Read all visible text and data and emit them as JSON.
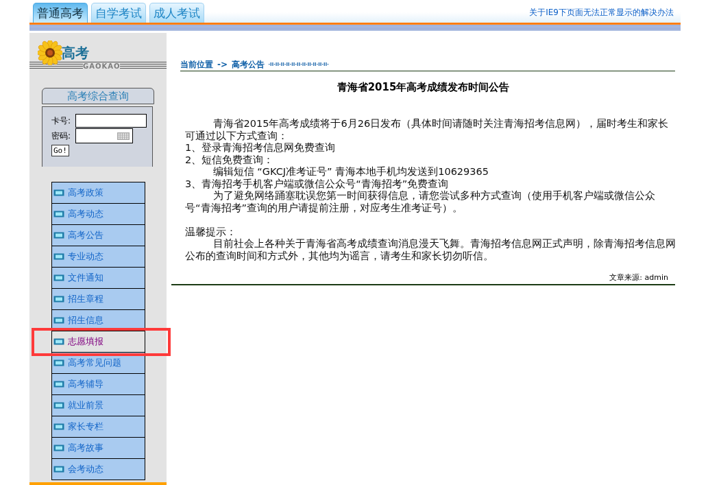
{
  "header": {
    "tabs": [
      {
        "label": "普通高考",
        "selected": true
      },
      {
        "label": "自学考试",
        "selected": false
      },
      {
        "label": "成人考试",
        "selected": false
      }
    ],
    "help_link": "关于IE9下页面无法正常显示的解决办法"
  },
  "sidebar": {
    "logo": {
      "title": "高考",
      "subtitle": "GAOKAO"
    },
    "login": {
      "title": "高考综合查询",
      "card_label": "卡号:",
      "password_label": "密码:",
      "submit": "Go!"
    },
    "menu": [
      {
        "label": "高考政策",
        "selected": false,
        "highlighted": false
      },
      {
        "label": "高考动态",
        "selected": false,
        "highlighted": false
      },
      {
        "label": "高考公告",
        "selected": false,
        "highlighted": false
      },
      {
        "label": "专业动态",
        "selected": false,
        "highlighted": false
      },
      {
        "label": "文件通知",
        "selected": false,
        "highlighted": false
      },
      {
        "label": "招生章程",
        "selected": false,
        "highlighted": false
      },
      {
        "label": "招生信息",
        "selected": false,
        "highlighted": false
      },
      {
        "label": "志愿填报",
        "selected": true,
        "highlighted": true
      },
      {
        "label": "高考常见问题",
        "selected": false,
        "highlighted": false
      },
      {
        "label": "高考辅导",
        "selected": false,
        "highlighted": false
      },
      {
        "label": "就业前景",
        "selected": false,
        "highlighted": false
      },
      {
        "label": "家长专栏",
        "selected": false,
        "highlighted": false
      },
      {
        "label": "高考故事",
        "selected": false,
        "highlighted": false
      },
      {
        "label": "会考动态",
        "selected": false,
        "highlighted": false
      }
    ]
  },
  "breadcrumb": {
    "label": "当前位置",
    "separator": "->",
    "current": "高考公告"
  },
  "article": {
    "title": "青海省2015年高考成绩发布时间公告",
    "paragraphs": [
      {
        "kind": "indented",
        "text": "青海省2015年高考成绩将于6月26日发布（具体时间请随时关注青海招考信息网），届时考生和家长可通过以下方式查询："
      },
      {
        "kind": "plain",
        "text": "1、登录青海招考信息网免费查询"
      },
      {
        "kind": "plain",
        "text": "2、短信免费查询："
      },
      {
        "kind": "indented",
        "text": "编辑短信 “GKCJ准考证号” 青海本地手机均发送到10629365"
      },
      {
        "kind": "plain",
        "text": "3、青海招考手机客户端或微信公众号“青海招考”免费查询"
      },
      {
        "kind": "indented",
        "text": "为了避免网络踊塞耽误您第一时间获得信息，请您尝试多种方式查询（使用手机客户端或微信公众号“青海招考”查询的用户请提前注册，对应考生准考证号）。"
      },
      {
        "kind": "gap"
      },
      {
        "kind": "plain",
        "text": "温馨提示："
      },
      {
        "kind": "indented",
        "text": "目前社会上各种关于青海省高考成绩查询消息漫天飞舞。青海招考信息网正式声明，除青海招考信息网公布的查询时间和方式外，其他均为谣言，请考生和家长切勿听信。"
      }
    ],
    "source": "文章来源: admin"
  }
}
